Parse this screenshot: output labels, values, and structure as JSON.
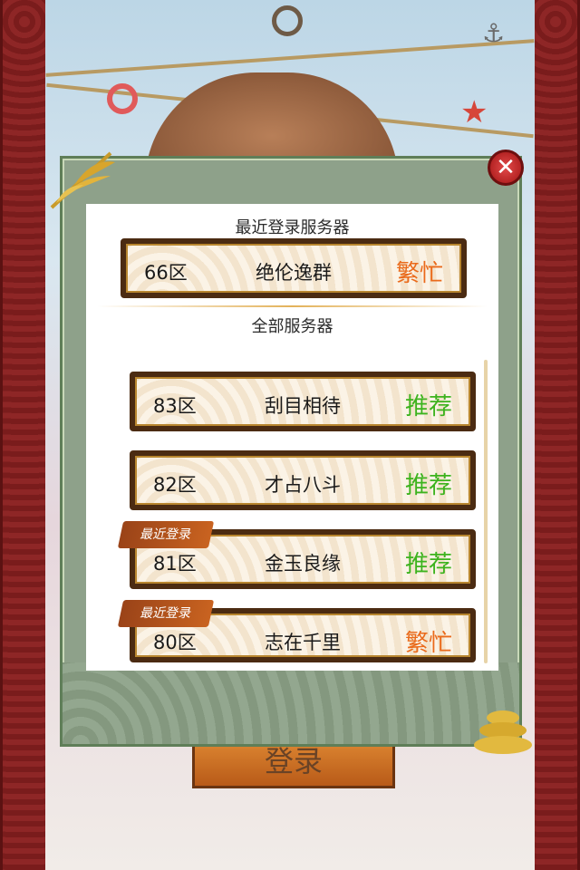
{
  "dialog": {
    "recent_section_title": "最近登录服务器",
    "all_section_title": "全部服务器"
  },
  "recent_server": {
    "zone": "66区",
    "name": "绝伦逸群",
    "status": "繁忙"
  },
  "servers": [
    {
      "zone": "83区",
      "name": "刮目相待",
      "status": "推荐",
      "recent": ""
    },
    {
      "zone": "82区",
      "name": "才占八斗",
      "status": "推荐",
      "recent": ""
    },
    {
      "zone": "81区",
      "name": "金玉良缘",
      "status": "推荐",
      "recent": "最近登录"
    },
    {
      "zone": "80区",
      "name": "志在千里",
      "status": "繁忙",
      "recent": "最近登录"
    }
  ],
  "login_button": {
    "label": "登录"
  },
  "colors": {
    "status_busy": "#ea6a1b",
    "status_recommended": "#3db31e",
    "dialog_bg": "#8ea18a",
    "close_button": "#c21f1f"
  },
  "icons": {
    "close": "close-icon",
    "bamboo": "bamboo-decoration",
    "pine": "pine-decoration"
  }
}
